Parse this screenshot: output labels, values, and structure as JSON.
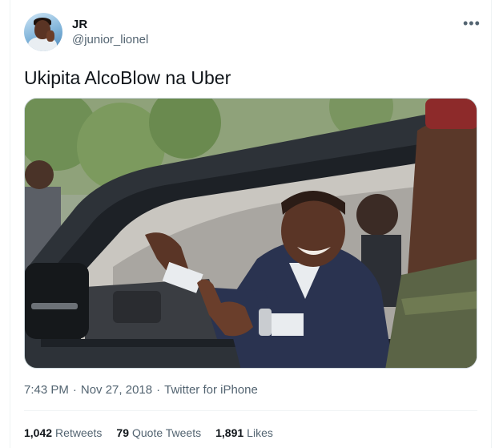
{
  "user": {
    "display_name": "JR",
    "handle": "@junior_lionel"
  },
  "tweet": {
    "text": "Ukipita AlcoBlow na Uber",
    "time": "7:43 PM",
    "date": "Nov 27, 2018",
    "source": "Twitter for iPhone",
    "separator": "·"
  },
  "menu": {
    "more_icon": "more-horizontal-icon",
    "glyph": "•••"
  },
  "stats": {
    "retweets_count": "1,042",
    "retweets_label": "Retweets",
    "quotes_count": "79",
    "quotes_label": "Quote Tweets",
    "likes_count": "1,891",
    "likes_label": "Likes"
  },
  "colors": {
    "text_primary": "#0f1419",
    "text_secondary": "#536471",
    "border": "#eff3f4"
  }
}
